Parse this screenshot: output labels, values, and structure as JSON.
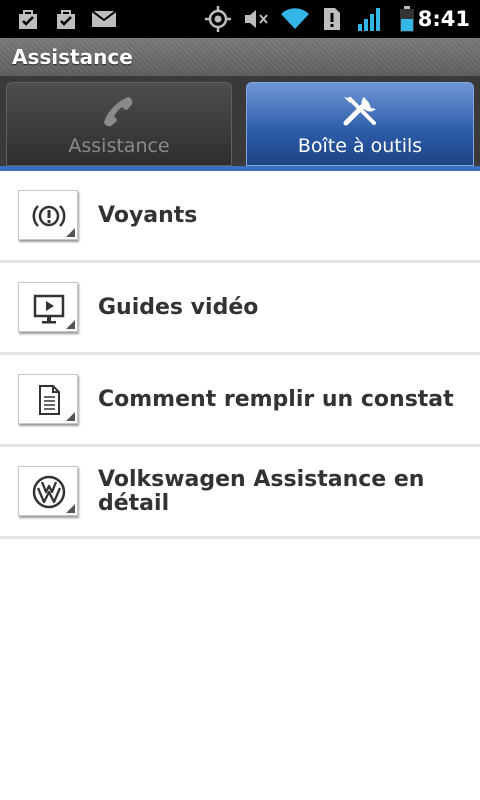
{
  "status_bar": {
    "time": "8:41",
    "icons": [
      "shopping-bag-check-icon",
      "shopping-bag-check-icon",
      "mail-icon",
      "gps-icon",
      "mute-icon",
      "wifi-icon",
      "alert-icon",
      "signal-icon",
      "battery-icon"
    ]
  },
  "title_bar": {
    "title": "Assistance"
  },
  "tabs": [
    {
      "label": "Assistance",
      "icon": "phone-icon",
      "active": false
    },
    {
      "label": "Boîte à outils",
      "icon": "tools-icon",
      "active": true
    }
  ],
  "list": {
    "items": [
      {
        "label": "Voyants",
        "icon": "warning-light-icon"
      },
      {
        "label": "Guides vidéo",
        "icon": "video-screen-icon"
      },
      {
        "label": "Comment remplir un constat",
        "icon": "document-icon"
      },
      {
        "label": "Volkswagen Assistance en détail",
        "icon": "vw-logo-icon"
      }
    ]
  },
  "colors": {
    "active_tab": "#2c5ba8",
    "tab_underline": "#3b6fbf",
    "status_accent": "#33b5e5"
  }
}
